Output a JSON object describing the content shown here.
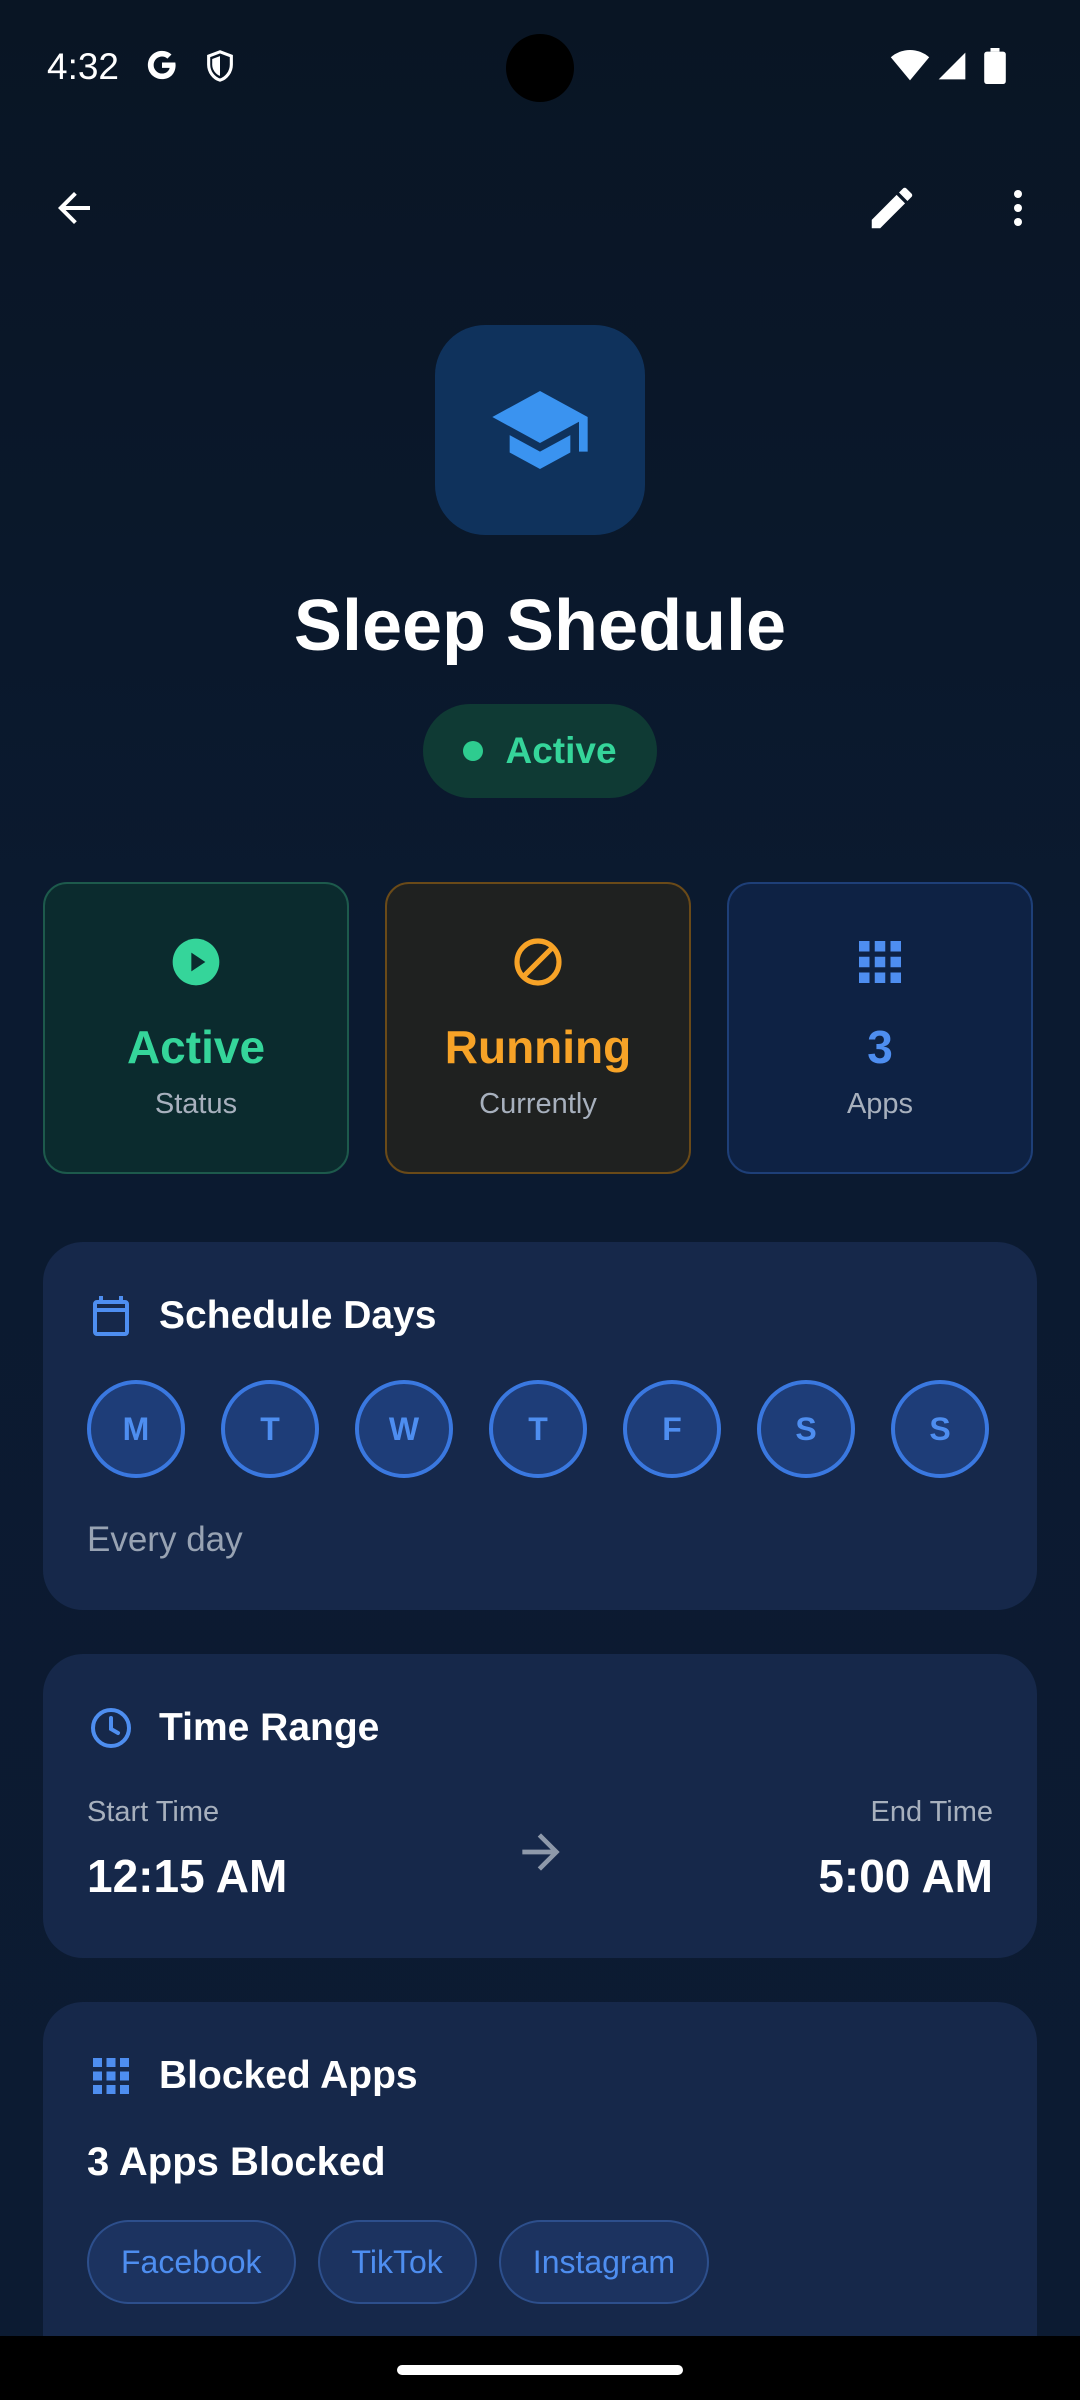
{
  "status_bar": {
    "time": "4:32"
  },
  "app_bar": {
    "back_icon": "arrow-back-icon",
    "edit_icon": "pencil-icon",
    "more_icon": "more-vert-icon"
  },
  "header": {
    "icon": "graduation-cap-icon",
    "title": "Sleep Shedule",
    "status": "Active",
    "status_color": "#35d59a"
  },
  "stats": [
    {
      "icon": "play-circle-icon",
      "value": "Active",
      "label": "Status",
      "color": "#35d59a"
    },
    {
      "icon": "block-icon",
      "value": "Running",
      "label": "Currently",
      "color": "#f7a327"
    },
    {
      "icon": "apps-grid-icon",
      "value": "3",
      "label": "Apps",
      "color": "#4e8ef0"
    }
  ],
  "schedule_days": {
    "title": "Schedule Days",
    "days": [
      "M",
      "T",
      "W",
      "T",
      "F",
      "S",
      "S"
    ],
    "caption": "Every day"
  },
  "time_range": {
    "title": "Time Range",
    "start_label": "Start Time",
    "start_value": "12:15 AM",
    "end_label": "End Time",
    "end_value": "5:00 AM"
  },
  "blocked_apps": {
    "title": "Blocked Apps",
    "count_text": "3 Apps Blocked",
    "apps": [
      "Facebook",
      "TikTok",
      "Instagram"
    ]
  },
  "colors": {
    "accent_blue": "#4e8ef0",
    "accent_green": "#35d59a",
    "accent_orange": "#f7a327",
    "card_bg": "#16284a"
  }
}
